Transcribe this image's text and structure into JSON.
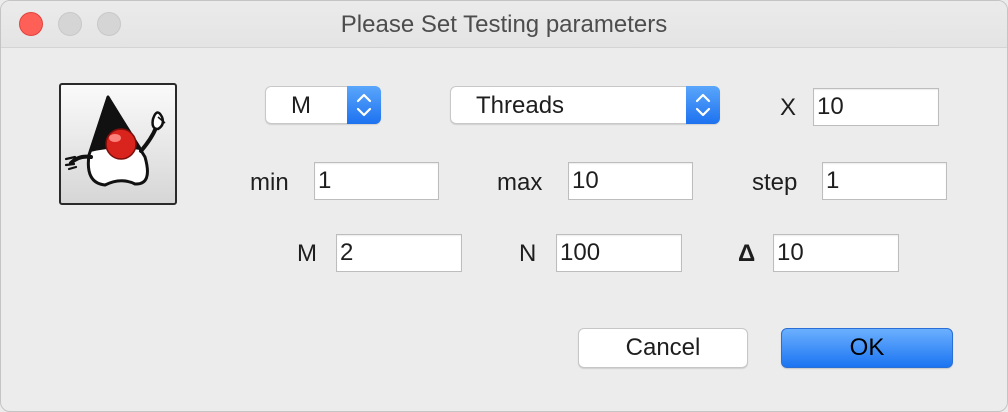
{
  "window": {
    "title": "Please Set Testing parameters"
  },
  "icons": {
    "app_icon": "java-duke-icon",
    "stepper_icon": "up-down-chevron-icon"
  },
  "colors": {
    "accent": "#1d72f0",
    "close_button": "#fe5f57"
  },
  "row1": {
    "mode_select": {
      "value": "M"
    },
    "param_select": {
      "value": "Threads"
    },
    "x_label": "X",
    "x_value": "10"
  },
  "row2": {
    "min_label": "min",
    "min_value": "1",
    "max_label": "max",
    "max_value": "10",
    "step_label": "step",
    "step_value": "1"
  },
  "row3": {
    "m_label": "M",
    "m_value": "2",
    "n_label": "N",
    "n_value": "100",
    "delta_label": "Δ",
    "delta_value": "10"
  },
  "buttons": {
    "cancel_label": "Cancel",
    "ok_label": "OK"
  }
}
